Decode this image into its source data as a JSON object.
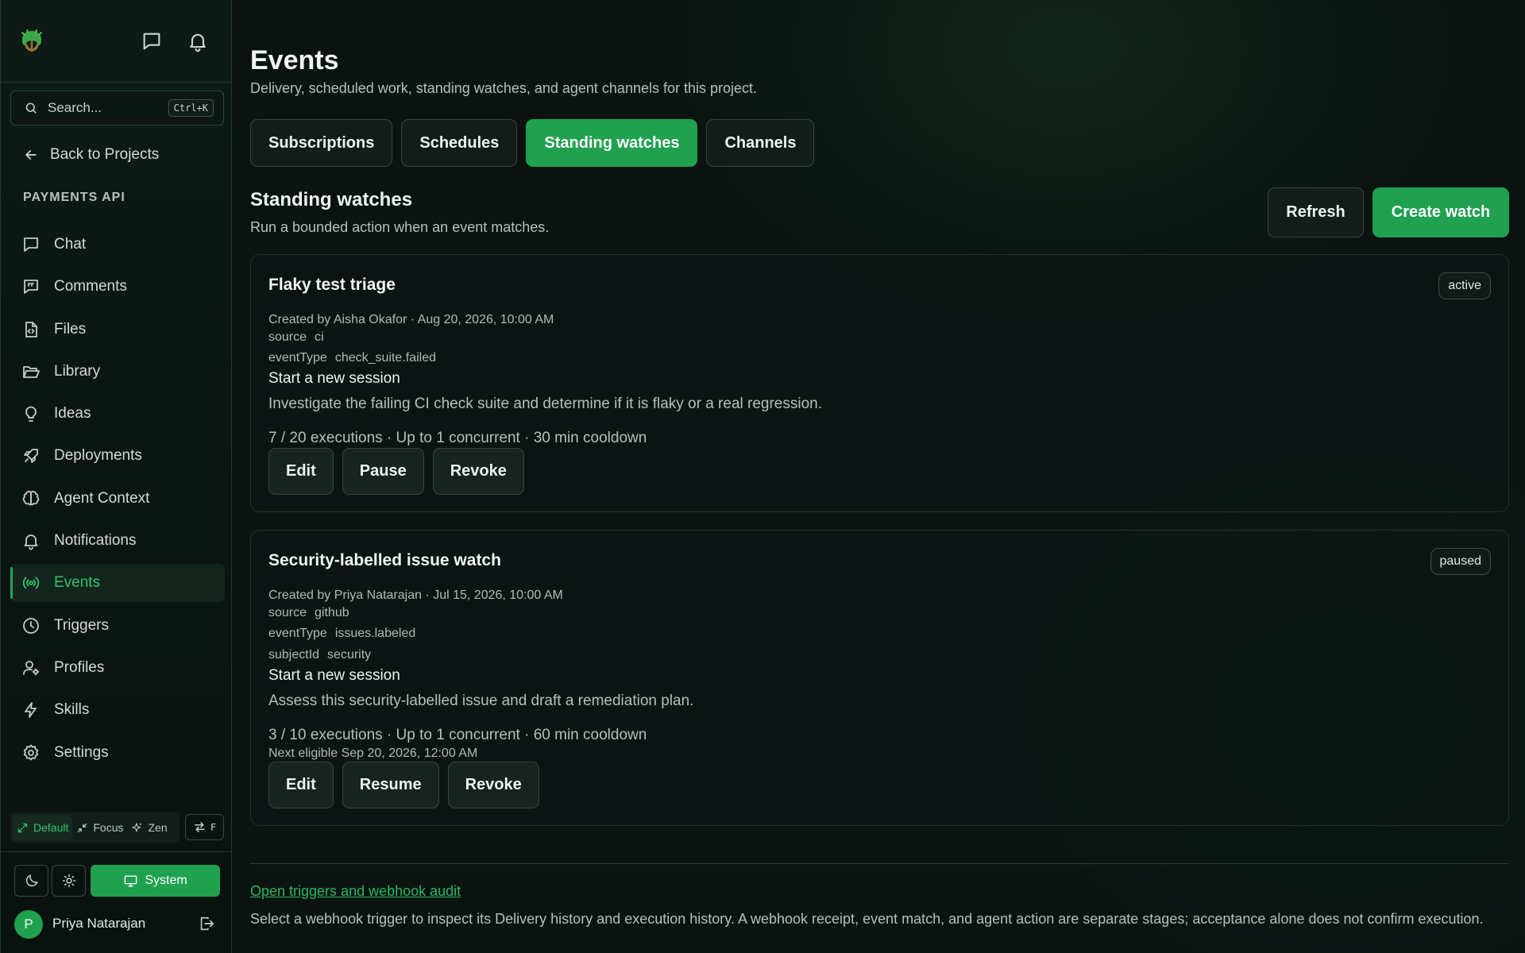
{
  "sidebar": {
    "search_placeholder": "Search...",
    "search_shortcut": "Ctrl+K",
    "back_label": "Back to Projects",
    "project_name": "PAYMENTS API",
    "nav": [
      {
        "label": "Chat",
        "icon": "chat-icon"
      },
      {
        "label": "Comments",
        "icon": "comments-icon"
      },
      {
        "label": "Files",
        "icon": "file-code-icon"
      },
      {
        "label": "Library",
        "icon": "folder-open-icon"
      },
      {
        "label": "Ideas",
        "icon": "lightbulb-icon"
      },
      {
        "label": "Deployments",
        "icon": "rocket-icon"
      },
      {
        "label": "Agent Context",
        "icon": "brain-icon"
      },
      {
        "label": "Notifications",
        "icon": "bell-icon"
      },
      {
        "label": "Events",
        "icon": "broadcast-icon",
        "active": true
      },
      {
        "label": "Triggers",
        "icon": "clock-icon"
      },
      {
        "label": "Profiles",
        "icon": "user-gear-icon"
      },
      {
        "label": "Skills",
        "icon": "lightning-icon"
      },
      {
        "label": "Settings",
        "icon": "gear-icon"
      }
    ],
    "modes": {
      "default": "Default",
      "focus": "Focus",
      "zen": "Zen",
      "active": "Default"
    },
    "swap_shortcut": "F",
    "theme": {
      "system_label": "System",
      "active": "System"
    },
    "user": {
      "name": "Priya Natarajan",
      "initial": "P"
    }
  },
  "page": {
    "title": "Events",
    "subtitle": "Delivery, scheduled work, standing watches, and agent channels for this project.",
    "tabs": [
      "Subscriptions",
      "Schedules",
      "Standing watches",
      "Channels"
    ],
    "active_tab": "Standing watches"
  },
  "section": {
    "title": "Standing watches",
    "subtitle": "Run a bounded action when an event matches.",
    "refresh_label": "Refresh",
    "create_label": "Create watch"
  },
  "watches": [
    {
      "title": "Flaky test triage",
      "status": "active",
      "created": "Created by Aisha Okafor · Aug 20, 2026, 10:00 AM",
      "filters": [
        {
          "key": "source",
          "value": "ci"
        },
        {
          "key": "eventType",
          "value": "check_suite.failed"
        }
      ],
      "action": "Start a new session",
      "description": "Investigate the failing CI check suite and determine if it is flaky or a real regression.",
      "stats": "7 / 20 executions · Up to 1 concurrent · 30 min cooldown",
      "buttons": [
        "Edit",
        "Pause",
        "Revoke"
      ]
    },
    {
      "title": "Security-labelled issue watch",
      "status": "paused",
      "created": "Created by Priya Natarajan · Jul 15, 2026, 10:00 AM",
      "filters": [
        {
          "key": "source",
          "value": "github"
        },
        {
          "key": "eventType",
          "value": "issues.labeled"
        },
        {
          "key": "subjectId",
          "value": "security"
        }
      ],
      "action": "Start a new session",
      "description": "Assess this security-labelled issue and draft a remediation plan.",
      "stats": "3 / 10 executions · Up to 1 concurrent · 60 min cooldown",
      "next_eligible": "Next eligible Sep 20, 2026, 12:00 AM",
      "buttons": [
        "Edit",
        "Resume",
        "Revoke"
      ]
    }
  ],
  "footer": {
    "link_label": "Open triggers and webhook audit",
    "text": "Select a webhook trigger to inspect its Delivery history and execution history. A webhook receipt, event match, and agent action are separate stages; acceptance alone does not confirm execution."
  },
  "colors": {
    "accent": "#1fa14f",
    "accent_text": "#2fc36a",
    "background": "#0b1311"
  }
}
